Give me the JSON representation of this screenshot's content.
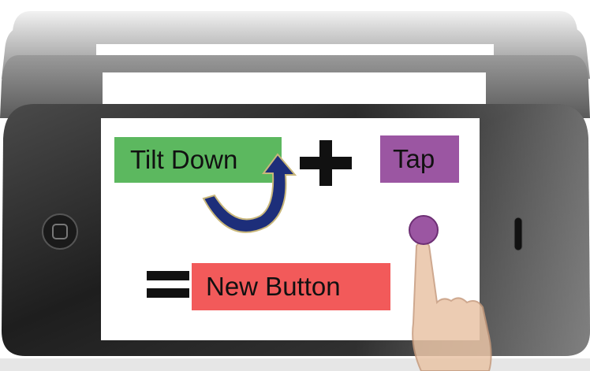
{
  "diagram": {
    "tilt_label": "Tilt Down",
    "tap_label": "Tap",
    "result_label": "New Button",
    "colors": {
      "tilt": "#5cb85f",
      "tap": "#9b56a2",
      "result": "#f25a5a",
      "arrow": "#1d2e7a",
      "phone_body": "#2b2b2b"
    },
    "icons": [
      "plus-icon",
      "equals-icon",
      "curved-arrow-icon",
      "touch-point-icon",
      "finger-icon",
      "home-button-icon"
    ]
  }
}
